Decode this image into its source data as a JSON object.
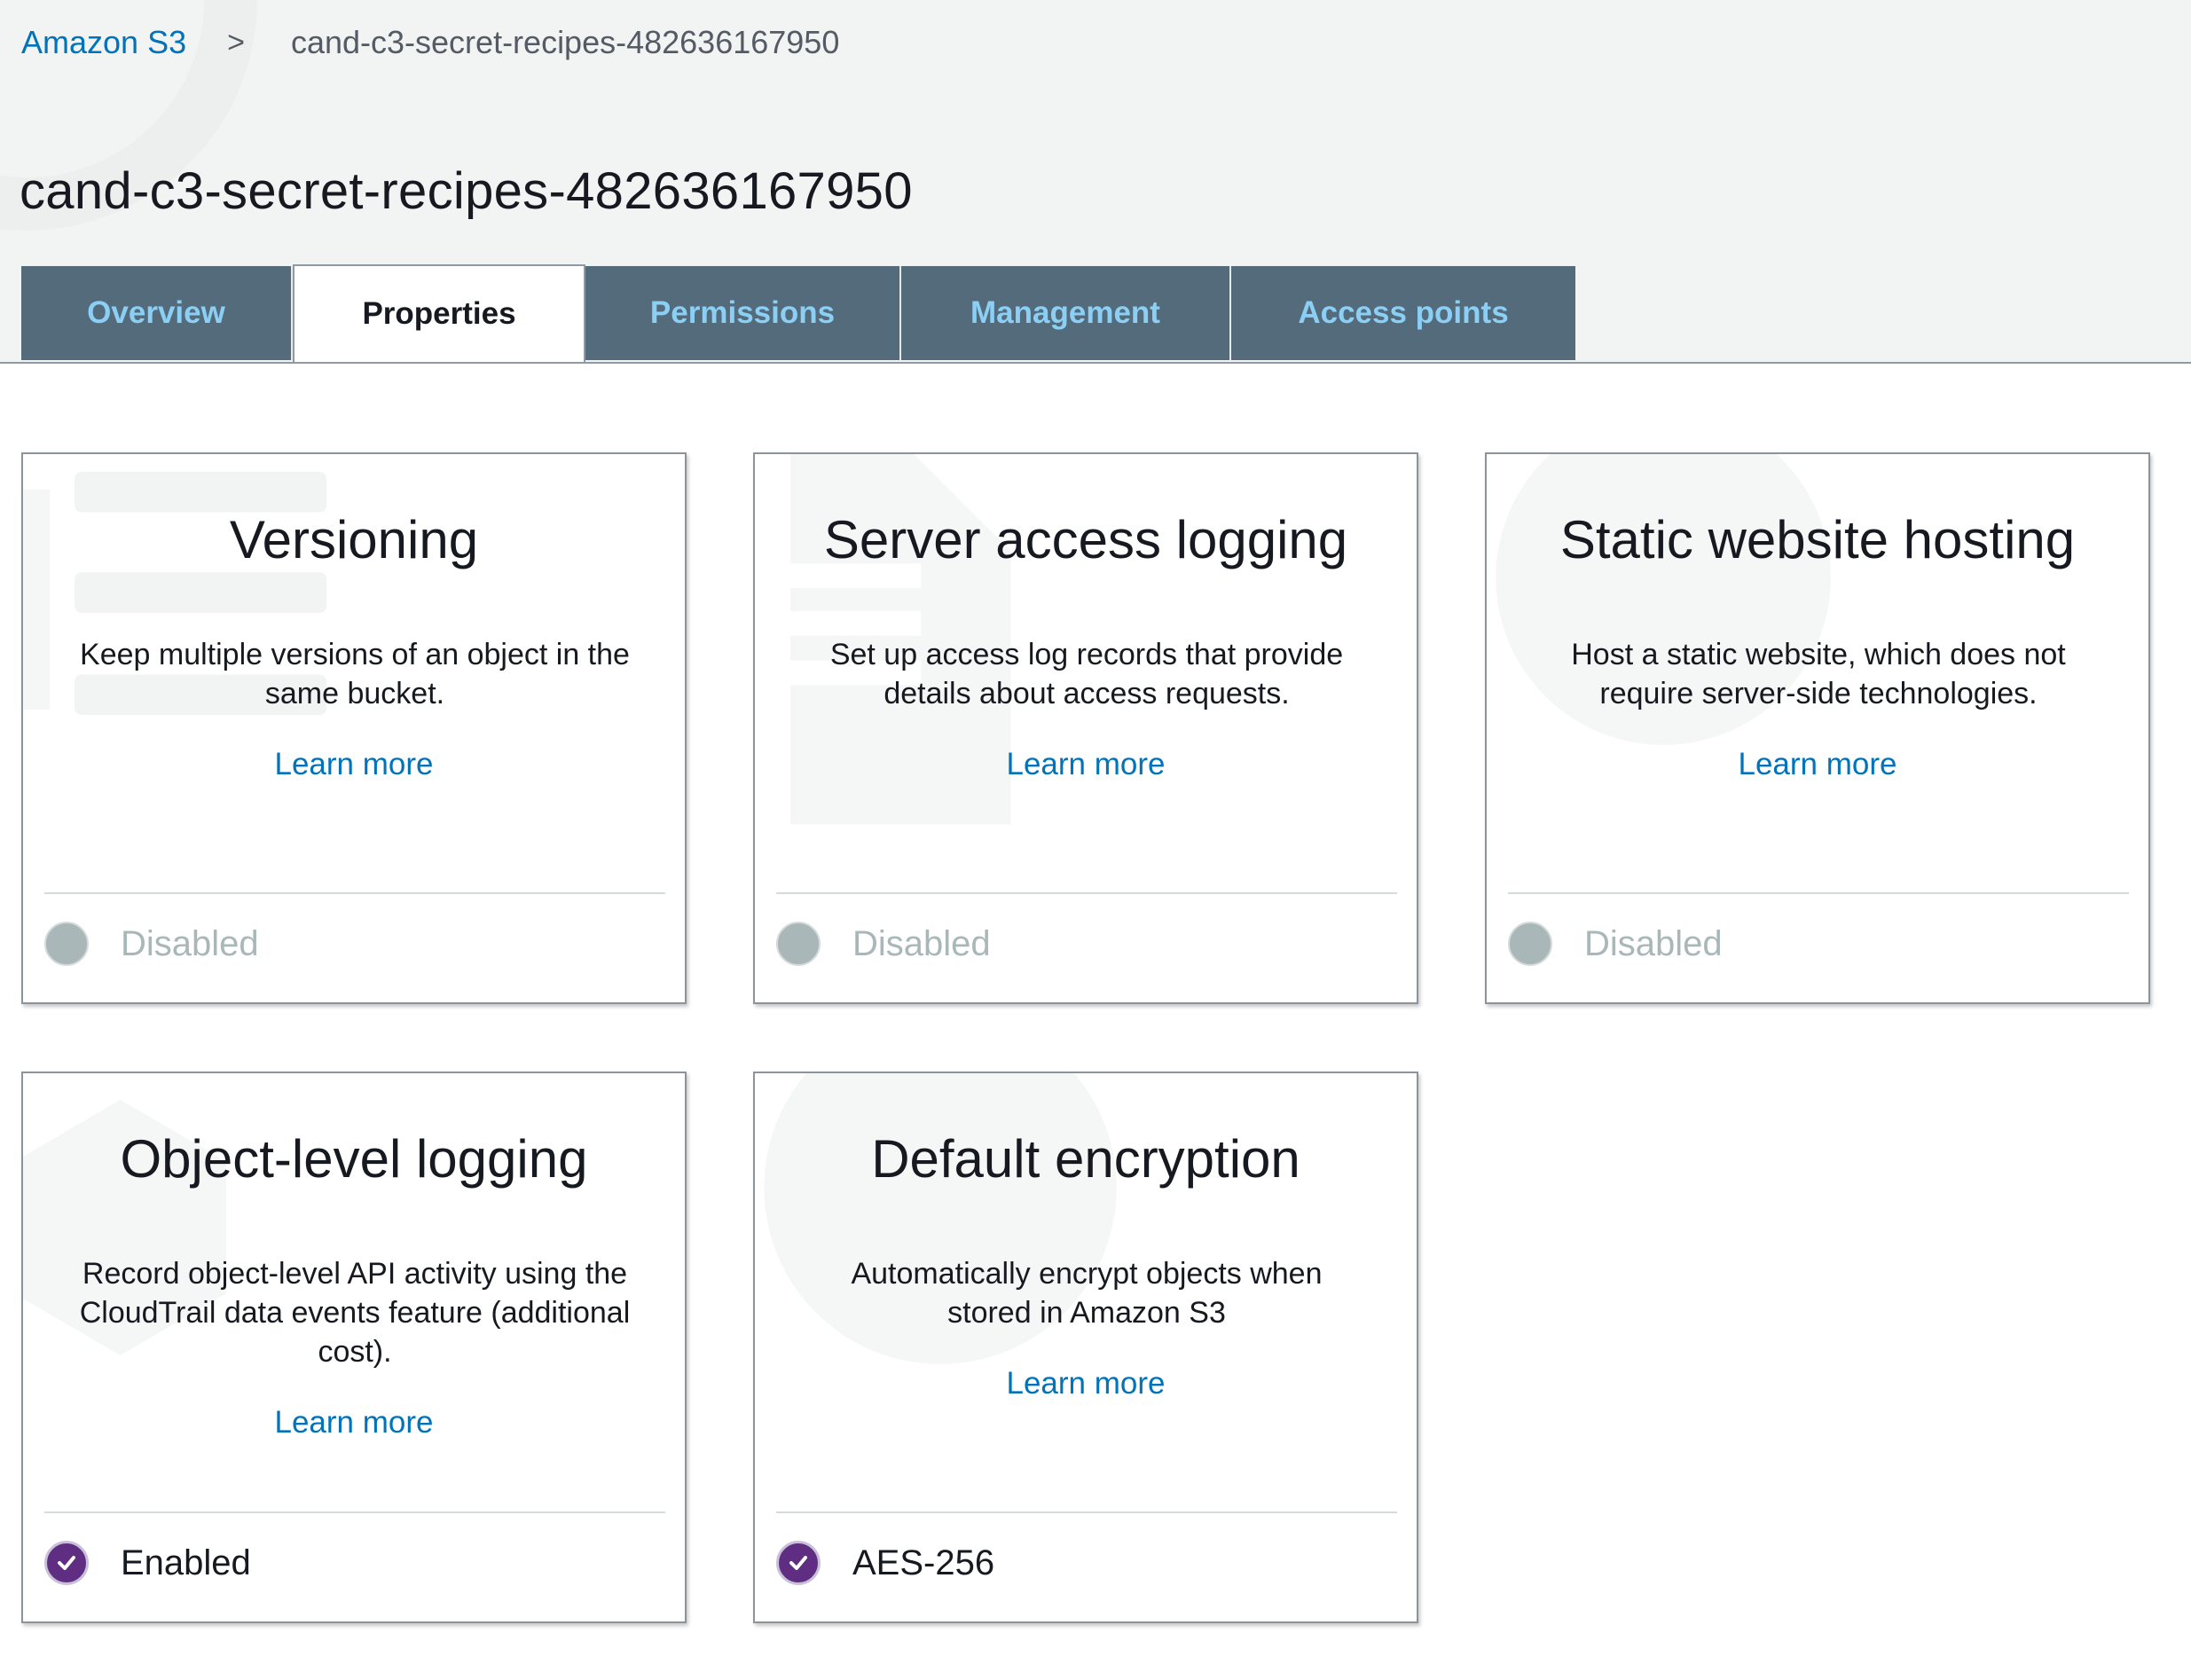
{
  "breadcrumb": {
    "root": "Amazon S3",
    "separator": ">",
    "current": "cand-c3-secret-recipes-482636167950"
  },
  "page_title": "cand-c3-secret-recipes-482636167950",
  "tabs": [
    {
      "label": "Overview",
      "active": false
    },
    {
      "label": "Properties",
      "active": true
    },
    {
      "label": "Permissions",
      "active": false
    },
    {
      "label": "Management",
      "active": false
    },
    {
      "label": "Access points",
      "active": false
    }
  ],
  "cards": {
    "versioning": {
      "title": "Versioning",
      "description": "Keep multiple versions of an object in the same bucket.",
      "link": "Learn more",
      "status": "Disabled",
      "status_icon": "disabled-circle-icon"
    },
    "server_access_logging": {
      "title": "Server access logging",
      "description": "Set up access log records that provide details about access requests.",
      "link": "Learn more",
      "status": "Disabled",
      "status_icon": "disabled-circle-icon"
    },
    "static_website_hosting": {
      "title": "Static website hosting",
      "description": "Host a static website, which does not require server-side technologies.",
      "link": "Learn more",
      "status": "Disabled",
      "status_icon": "disabled-circle-icon"
    },
    "object_level_logging": {
      "title": "Object-level logging",
      "description": "Record object-level API activity using the CloudTrail data events feature (additional cost).",
      "link": "Learn more",
      "status": "Enabled",
      "status_icon": "check-circle-icon"
    },
    "default_encryption": {
      "title": "Default encryption",
      "description": "Automatically encrypt objects when stored in Amazon S3",
      "link": "Learn more",
      "status": "AES-256",
      "status_icon": "check-circle-icon"
    }
  },
  "colors": {
    "link": "#0073bb",
    "tab_bg": "#546b7b",
    "tab_text": "#8ccff4",
    "enabled": "#5f2d82",
    "disabled": "#aab7b8",
    "header_bg": "#f2f3f3"
  }
}
